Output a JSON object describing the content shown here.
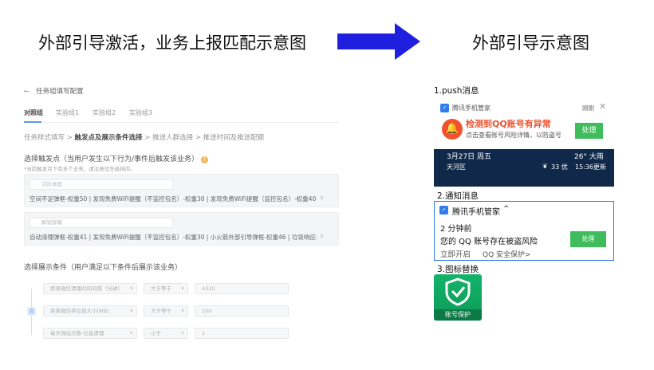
{
  "titles": {
    "left": "外部引导激活，业务上报匹配示意图",
    "right": "外部引导示意图"
  },
  "form": {
    "back_icon": "←",
    "breadcrumb": "任务组填写配置",
    "tabs": [
      "对照组",
      "实验组1",
      "实验组2",
      "实验组3"
    ],
    "steps": {
      "s1": "任务样式填写",
      "sep": ">",
      "s2": "触发点及展示条件选择",
      "s3": "推送人群选择",
      "s4": "推送时间及推送配额"
    },
    "trigger_title": "选择触发点（当用户发生以下行为/事件后触发该业务）",
    "trigger_note": "*当前触发点下有多个业务，请注意优先级排序。",
    "box1_select": "活跃桌面",
    "box1_text": "空间不足弹框-权重50 | 发现免费WiFi提醒（不监控包名）-权重30 | 发现免费WiFi提醒（监控包名）-权重40 | WiFi...",
    "box2_select": "解锁屏幕",
    "box2_text": "自动清理弹框-权重41 | 发现免费WiFi提醒（不监控包名）-权重30 | 小火箭外部引导弹框-权重46 | 垃圾响应权限弹...",
    "cond_title": "选择展示条件（用户满足以下条件后展示该业务）",
    "and_label": "且",
    "conditions": [
      {
        "field": "距离微信清理时间间隔（分钟）",
        "op": "大于等于",
        "value": "4320"
      },
      {
        "field": "距离微信存垃圾大小(MB)",
        "op": "大于等于",
        "value": "100"
      },
      {
        "field": "每天弹出次数-垃圾清理",
        "op": "小于",
        "value": "1"
      }
    ]
  },
  "right": {
    "push_label": "1.push消息",
    "push": {
      "app_name": "腾讯手机管家",
      "dismiss": "刚刚",
      "close_icon": "✕",
      "headline": "检测到QQ账号有异常",
      "sub": "点击查看账号风险详情，以防盗号",
      "button": "处理",
      "date": "3月27日 周五",
      "weather": "26° 大雨",
      "location": "天河区",
      "aqi": "33 优",
      "update": "15:36更新"
    },
    "notice_label": "2.通知消息",
    "notice": {
      "app_name": "腾讯手机管家",
      "chevron": "^",
      "time": "2 分钟前",
      "text": "您的 QQ 账号存在被盗风险",
      "action": "立即开启",
      "sub": "QQ 安全保护>",
      "button": "处理"
    },
    "icon_label": "3.图标替换",
    "icon_text": "账号保护"
  },
  "colors": {
    "arrow": "#1f1fe0",
    "accent": "#2f7bea",
    "alert_red": "#f0522e",
    "button_green": "#3fbd5c"
  }
}
